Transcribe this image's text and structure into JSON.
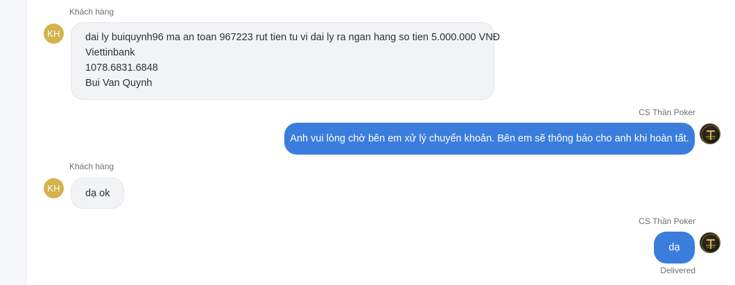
{
  "messages": [
    {
      "direction": "incoming",
      "sender": "Khách hàng",
      "avatar_initials": "KH",
      "lines": [
        "dai ly buiquynh96 ma an toan 967223 rut tien tu vi dai ly ra ngan hang so tien 5.000.000 VNĐ",
        "Viettinbank",
        "1078.6831.6848",
        "Bui Van Quynh"
      ]
    },
    {
      "direction": "outgoing",
      "sender": "CS Thần Poker",
      "avatar_icon": "than-poker-logo-icon",
      "text": "Anh vui lòng chờ bên em xử lý chuyển khoản. Bên em sẽ thông báo cho anh khi hoàn tất."
    },
    {
      "direction": "incoming",
      "sender": "Khách hàng",
      "avatar_initials": "KH",
      "text": "dạ ok"
    },
    {
      "direction": "outgoing",
      "sender": "CS Thần Poker",
      "avatar_icon": "than-poker-logo-icon",
      "text": "dạ",
      "status": "Delivered"
    }
  ],
  "colors": {
    "outgoing_bubble": "#3b7ddd",
    "incoming_bubble": "#f1f3f5",
    "customer_avatar": "#d4b24c"
  }
}
